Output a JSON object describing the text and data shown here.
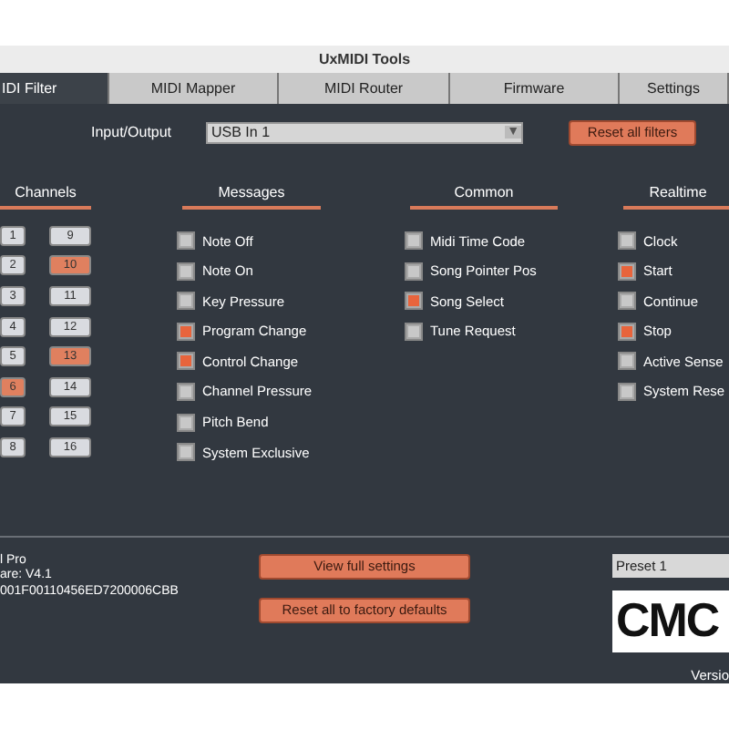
{
  "window": {
    "title": "UxMIDI Tools"
  },
  "tabs": [
    {
      "label": "IDI Filter",
      "selected": true
    },
    {
      "label": "MIDI Mapper",
      "selected": false
    },
    {
      "label": "MIDI Router",
      "selected": false
    },
    {
      "label": "Firmware",
      "selected": false
    },
    {
      "label": "Settings",
      "selected": false
    }
  ],
  "io": {
    "label": "Input/Output",
    "value": "USB In 1",
    "arrow": "▼"
  },
  "reset_filters": "Reset all filters",
  "channels": {
    "heading": "Channels",
    "items": [
      {
        "label": "1",
        "selected": false
      },
      {
        "label": "2",
        "selected": false
      },
      {
        "label": "3",
        "selected": false
      },
      {
        "label": "4",
        "selected": false
      },
      {
        "label": "5",
        "selected": false
      },
      {
        "label": "6",
        "selected": true
      },
      {
        "label": "7",
        "selected": false
      },
      {
        "label": "8",
        "selected": false
      },
      {
        "label": "9",
        "selected": false
      },
      {
        "label": "10",
        "selected": true
      },
      {
        "label": "11",
        "selected": false
      },
      {
        "label": "12",
        "selected": false
      },
      {
        "label": "13",
        "selected": true
      },
      {
        "label": "14",
        "selected": false
      },
      {
        "label": "15",
        "selected": false
      },
      {
        "label": "16",
        "selected": false
      }
    ]
  },
  "groups": [
    {
      "heading": "Messages",
      "items": [
        {
          "label": "Note Off",
          "checked": false
        },
        {
          "label": "Note On",
          "checked": false
        },
        {
          "label": "Key Pressure",
          "checked": false
        },
        {
          "label": "Program Change",
          "checked": true
        },
        {
          "label": "Control Change",
          "checked": true
        },
        {
          "label": "Channel Pressure",
          "checked": false
        },
        {
          "label": "Pitch Bend",
          "checked": false
        },
        {
          "label": "System Exclusive",
          "checked": false
        }
      ]
    },
    {
      "heading": "Common",
      "items": [
        {
          "label": "Midi Time Code",
          "checked": false
        },
        {
          "label": "Song Pointer Pos",
          "checked": false
        },
        {
          "label": "Song Select",
          "checked": true
        },
        {
          "label": "Tune Request",
          "checked": false
        }
      ]
    },
    {
      "heading": "Realtime",
      "items": [
        {
          "label": "Clock",
          "checked": false
        },
        {
          "label": "Start",
          "checked": true
        },
        {
          "label": "Continue",
          "checked": false
        },
        {
          "label": "Stop",
          "checked": true
        },
        {
          "label": "Active Sense",
          "checked": false
        },
        {
          "label": "System Rese",
          "checked": false
        }
      ]
    }
  ],
  "device_info": [
    "l Pro",
    "are: V4.1",
    "001F00110456ED7200006CBB"
  ],
  "buttons": [
    "View full settings",
    "Reset all to factory defaults"
  ],
  "preset": "Preset 1",
  "logo": "CMC",
  "version": "Versio"
}
